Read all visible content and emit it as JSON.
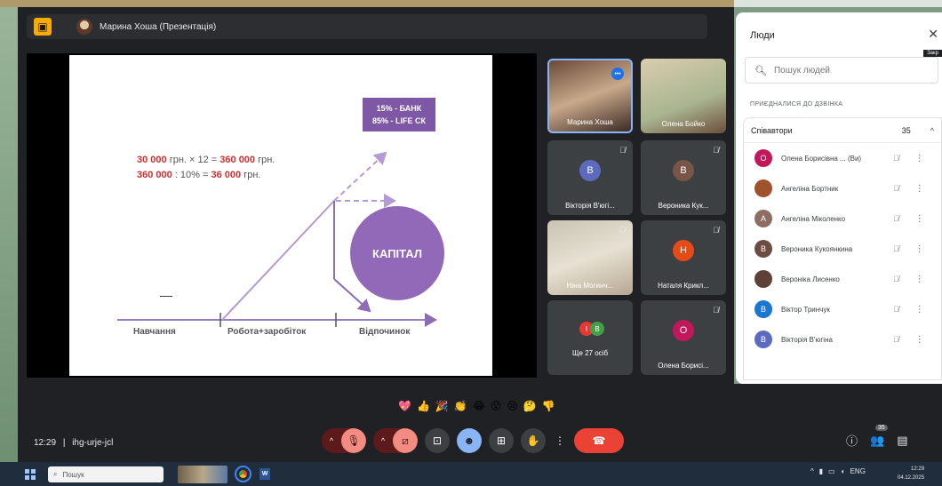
{
  "topbar": {
    "presenter_title": "Марина Хоша (Презентація)"
  },
  "slide": {
    "formula1": {
      "a": "30 000",
      "b": " грн. × 12 = ",
      "c": "360 000",
      "d": " грн."
    },
    "formula2": {
      "a": "360 000",
      "b": " : 10% = ",
      "c": "36 000",
      "d": " грн."
    },
    "bank_line1": "15% - БАНК",
    "bank_line2": "85% - LIFE СК",
    "capital": "КАПІТАЛ",
    "dash": "—",
    "phases": [
      "Навчання",
      "Робота+заробіток",
      "Відпочинок"
    ]
  },
  "tiles": [
    {
      "name": "Марина Хоша",
      "initial": ""
    },
    {
      "name": "Олена Бойко",
      "initial": ""
    },
    {
      "name": "Вікторія В'югі...",
      "initial": "В",
      "color": "#5c6bc0"
    },
    {
      "name": "Вероника Кук...",
      "initial": "В",
      "color": "#795548"
    },
    {
      "name": "Ніна Могинч...",
      "initial": ""
    },
    {
      "name": "Наталя Крикл...",
      "initial": "Н",
      "color": "#e64a19"
    },
    {
      "name": "Ще 27 осіб",
      "initial": ""
    },
    {
      "name": "Олена Борисі...",
      "initial": "О",
      "color": "#c2185b"
    }
  ],
  "group_avatars": [
    "І",
    "В"
  ],
  "reactions": [
    "💖",
    "👍",
    "🎉",
    "👏",
    "😂",
    "😮",
    "😢",
    "🤔",
    "👎"
  ],
  "meeting": {
    "time": "12:29",
    "separator": "|",
    "code": "ihg-urje-jcl"
  },
  "people": {
    "title": "Люди",
    "tooltip": "Закр",
    "search_placeholder": "Пошук людей",
    "joined_label": "ПРИЄДНАЛИСЯ ДО ДЗВІНКА",
    "section_title": "Співавтори",
    "count": "35",
    "list": [
      {
        "name": "Олена Борисівна ... (Ви)",
        "initial": "О",
        "color": "#c2185b"
      },
      {
        "name": "Ангеліна Бортник",
        "initial": "",
        "color": "#a0522d"
      },
      {
        "name": "Ангеліна Міколенко",
        "initial": "А",
        "color": "#8d6e63"
      },
      {
        "name": "Вероника Кукоянкина",
        "initial": "В",
        "color": "#6d4c41"
      },
      {
        "name": "Вероніка Лисенко",
        "initial": "",
        "color": "#5d4037"
      },
      {
        "name": "Віктор Тринчук",
        "initial": "В",
        "color": "#1976d2"
      },
      {
        "name": "Вікторія В'югіна",
        "initial": "В",
        "color": "#5c6bc0"
      }
    ]
  },
  "people_badge": "35",
  "taskbar": {
    "search_label": "Пошук",
    "lang": "ENG",
    "time": "12:29",
    "date": "04.12.2025"
  },
  "colors": {
    "accent_red": "#d32f2f",
    "purple": "#9268b8",
    "end_call": "#ea4335"
  }
}
